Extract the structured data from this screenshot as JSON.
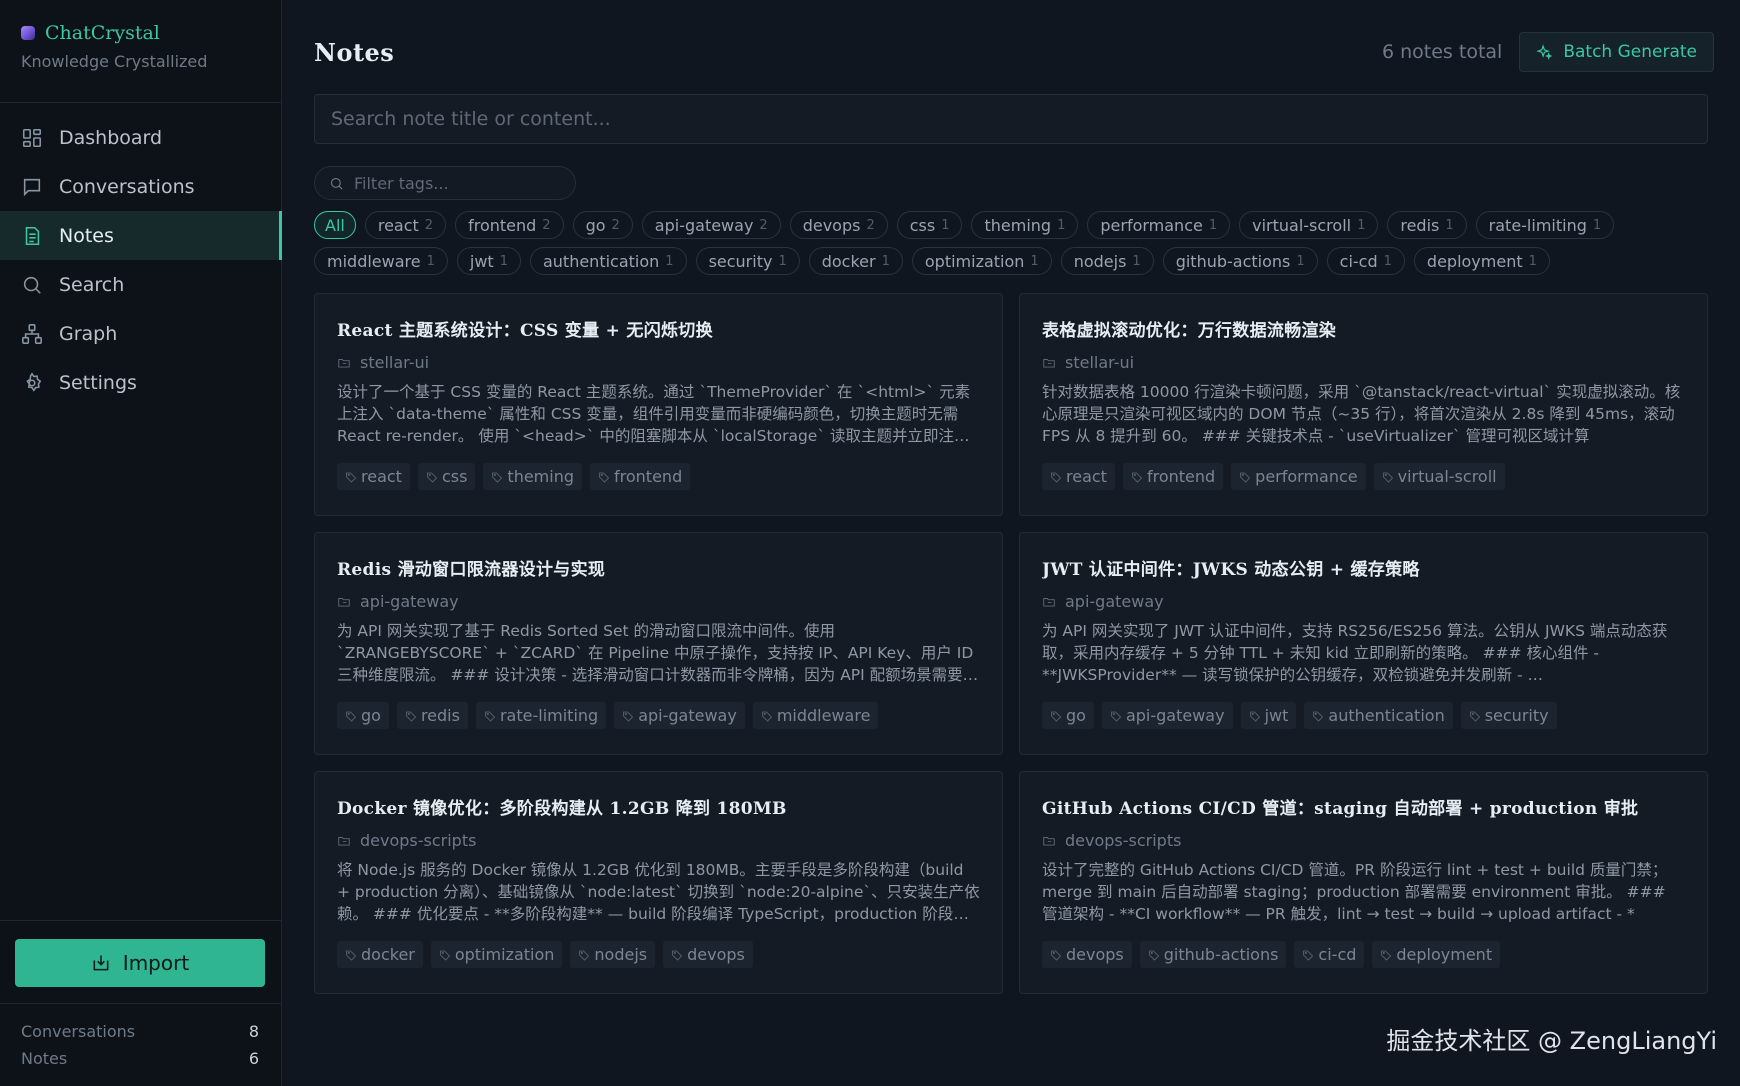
{
  "brand": {
    "name": "ChatCrystal",
    "subtitle": "Knowledge Crystallized"
  },
  "nav": [
    {
      "key": "dashboard",
      "label": "Dashboard",
      "icon": "dashboard-icon"
    },
    {
      "key": "conversations",
      "label": "Conversations",
      "icon": "chat-bubble-icon"
    },
    {
      "key": "notes",
      "label": "Notes",
      "icon": "note-icon",
      "active": true
    },
    {
      "key": "search",
      "label": "Search",
      "icon": "search-icon"
    },
    {
      "key": "graph",
      "label": "Graph",
      "icon": "graph-icon"
    },
    {
      "key": "settings",
      "label": "Settings",
      "icon": "gear-icon"
    }
  ],
  "import_label": "Import",
  "stats": {
    "conversations_label": "Conversations",
    "conversations_count": "8",
    "notes_label": "Notes",
    "notes_count": "6"
  },
  "header": {
    "title": "Notes",
    "total": "6 notes total",
    "batch_label": "Batch Generate"
  },
  "search": {
    "placeholder": "Search note title or content..."
  },
  "filter": {
    "placeholder": "Filter tags..."
  },
  "tag_filters": [
    {
      "name": "All",
      "count": "",
      "active": true
    },
    {
      "name": "react",
      "count": "2"
    },
    {
      "name": "frontend",
      "count": "2"
    },
    {
      "name": "go",
      "count": "2"
    },
    {
      "name": "api-gateway",
      "count": "2"
    },
    {
      "name": "devops",
      "count": "2"
    },
    {
      "name": "css",
      "count": "1"
    },
    {
      "name": "theming",
      "count": "1"
    },
    {
      "name": "performance",
      "count": "1"
    },
    {
      "name": "virtual-scroll",
      "count": "1"
    },
    {
      "name": "redis",
      "count": "1"
    },
    {
      "name": "rate-limiting",
      "count": "1"
    },
    {
      "name": "middleware",
      "count": "1"
    },
    {
      "name": "jwt",
      "count": "1"
    },
    {
      "name": "authentication",
      "count": "1"
    },
    {
      "name": "security",
      "count": "1"
    },
    {
      "name": "docker",
      "count": "1"
    },
    {
      "name": "optimization",
      "count": "1"
    },
    {
      "name": "nodejs",
      "count": "1"
    },
    {
      "name": "github-actions",
      "count": "1"
    },
    {
      "name": "ci-cd",
      "count": "1"
    },
    {
      "name": "deployment",
      "count": "1"
    }
  ],
  "notes": [
    {
      "title": "React 主题系统设计：CSS 变量 + 无闪烁切换",
      "project": "stellar-ui",
      "body": "设计了一个基于 CSS 变量的 React 主题系统。通过 `ThemeProvider` 在 `<html>` 元素上注入 `data-theme` 属性和 CSS 变量，组件引用变量而非硬编码颜色，切换主题时无需 React re-render。 使用 `<head>` 中的阻塞脚本从 `localStorage` 读取主题并立即注入，避免首屏闪烁。",
      "tags": [
        "react",
        "css",
        "theming",
        "frontend"
      ]
    },
    {
      "title": "表格虚拟滚动优化：万行数据流畅渲染",
      "project": "stellar-ui",
      "body": "针对数据表格 10000 行渲染卡顿问题，采用 `@tanstack/react-virtual` 实现虚拟滚动。核心原理是只渲染可视区域内的 DOM 节点（~35 行），将首次渲染从 2.8s 降到 45ms，滚动 FPS 从 8 提升到 60。 ### 关键技术点 - `useVirtualizer` 管理可视区域计算",
      "tags": [
        "react",
        "frontend",
        "performance",
        "virtual-scroll"
      ]
    },
    {
      "title": "Redis 滑动窗口限流器设计与实现",
      "project": "api-gateway",
      "body": "为 API 网关实现了基于 Redis Sorted Set 的滑动窗口限流中间件。使用 `ZRANGEBYSCORE` + `ZCARD` 在 Pipeline 中原子操作，支持按 IP、API Key、用户 ID 三种维度限流。 ### 设计决策 - 选择滑动窗口计数器而非令牌桶，因为 API 配额场景需要精确计数",
      "tags": [
        "go",
        "redis",
        "rate-limiting",
        "api-gateway",
        "middleware"
      ]
    },
    {
      "title": "JWT 认证中间件：JWKS 动态公钥 + 缓存策略",
      "project": "api-gateway",
      "body": "为 API 网关实现了 JWT 认证中间件，支持 RS256/ES256 算法。公钥从 JWKS 端点动态获取，采用内存缓存 + 5 分钟 TTL + 未知 kid 立即刷新的策略。 ### 核心组件 - **JWKSProvider** — 读写锁保护的公钥缓存，双检锁避免并发刷新 - …",
      "tags": [
        "go",
        "api-gateway",
        "jwt",
        "authentication",
        "security"
      ]
    },
    {
      "title": "Docker 镜像优化：多阶段构建从 1.2GB 降到 180MB",
      "project": "devops-scripts",
      "body": "将 Node.js 服务的 Docker 镜像从 1.2GB 优化到 180MB。主要手段是多阶段构建（build + production 分离）、基础镜像从 `node:latest` 切换到 `node:20-alpine`、只安装生产依赖。 ### 优化要点 - **多阶段构建** — build 阶段编译 TypeScript，production 阶段只复制产物",
      "tags": [
        "docker",
        "optimization",
        "nodejs",
        "devops"
      ]
    },
    {
      "title": "GitHub Actions CI/CD 管道：staging 自动部署 + production 审批",
      "project": "devops-scripts",
      "body": "设计了完整的 GitHub Actions CI/CD 管道。PR 阶段运行 lint + test + build 质量门禁；merge 到 main 后自动部署 staging；production 部署需要 environment 审批。 ### 管道架构 - **CI workflow** — PR 触发，lint → test → build → upload artifact - *",
      "tags": [
        "devops",
        "github-actions",
        "ci-cd",
        "deployment"
      ]
    }
  ],
  "watermark": "掘金技术社区 @ ZengLiangYi"
}
